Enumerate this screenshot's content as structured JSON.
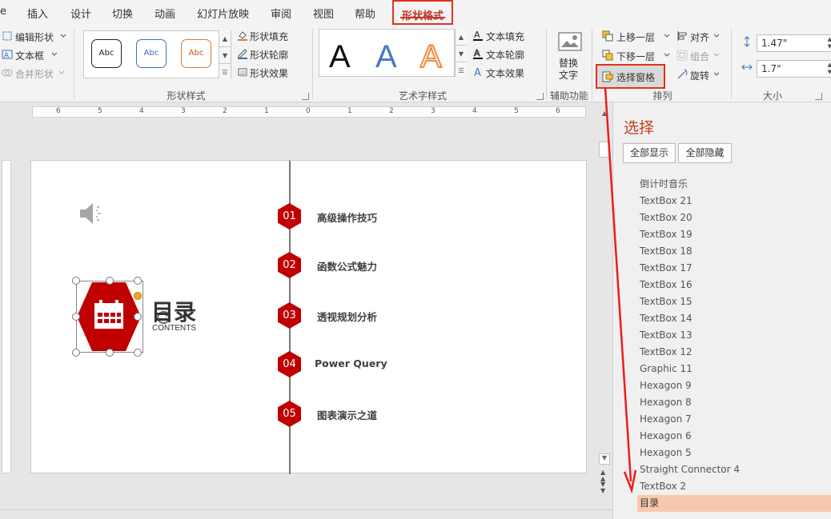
{
  "tabs": {
    "partial_file": "e",
    "insert": "插入",
    "design": "设计",
    "transitions": "切换",
    "animations": "动画",
    "slideshow": "幻灯片放映",
    "review": "审阅",
    "view": "视图",
    "help": "帮助",
    "shape_format": "形状格式"
  },
  "ribbon": {
    "insert_shapes": {
      "edit_shape": "编辑形状",
      "text_box": "文本框",
      "merge_shapes": "合并形状"
    },
    "shape_styles": {
      "label": "形状样式",
      "preset_text": "Abc",
      "fill": "形状填充",
      "outline": "形状轮廓",
      "effects": "形状效果"
    },
    "wordart": {
      "label": "艺术字样式",
      "letter": "A",
      "text_fill": "文本填充",
      "text_outline": "文本轮廓",
      "text_effects": "文本效果"
    },
    "accessibility": {
      "label": "辅助功能",
      "alt_text_line1": "替换",
      "alt_text_line2": "文字"
    },
    "arrange": {
      "label": "排列",
      "bring_forward": "上移一层",
      "send_backward": "下移一层",
      "selection_pane": "选择窗格",
      "align": "对齐",
      "group": "组合",
      "rotate": "旋转"
    },
    "size": {
      "label": "大小",
      "height": "1.47\"",
      "width": "1.7\""
    }
  },
  "ruler": {
    "labels": [
      "6",
      "5",
      "4",
      "3",
      "2",
      "1",
      "0",
      "1",
      "2",
      "3",
      "4",
      "5",
      "6"
    ]
  },
  "slide": {
    "title": "目录",
    "subtitle": "CONTENTS",
    "items": [
      {
        "num": "01",
        "text": "高级操作技巧"
      },
      {
        "num": "02",
        "text": "函数公式魅力"
      },
      {
        "num": "03",
        "text": "透视规划分析"
      },
      {
        "num": "04",
        "text": "Power Query"
      },
      {
        "num": "05",
        "text": "图表演示之道"
      }
    ]
  },
  "selection_pane": {
    "title": "选择",
    "show_all": "全部显示",
    "hide_all": "全部隐藏",
    "items": [
      "倒计时音乐",
      "TextBox 21",
      "TextBox 20",
      "TextBox 19",
      "TextBox 18",
      "TextBox 17",
      "TextBox 16",
      "TextBox 15",
      "TextBox 14",
      "TextBox 13",
      "TextBox 12",
      "Graphic 11",
      "Hexagon 9",
      "Hexagon 8",
      "Hexagon 7",
      "Hexagon 6",
      "Hexagon 5",
      "Straight Connector 4",
      "TextBox 2",
      "目录"
    ],
    "selected": "目录"
  },
  "colors": {
    "accent_red": "#c00000",
    "highlight_box": "#e0321e",
    "selected_row": "#f8c8ae"
  }
}
